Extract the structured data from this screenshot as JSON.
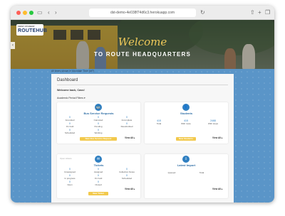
{
  "browser": {
    "url": "dst-demo-4e038f74d6c3.herokuapp.com"
  },
  "hero": {
    "logo_small": "FIRST STUDENT",
    "logo_main": "ROUTEHUB",
    "welcome": "Welcome",
    "subtitle": "TO ROUTE HEADQUARTERS"
  },
  "timezone_note": "All times shown in Mountain Time (MT)",
  "page": {
    "title": "Dashboard",
    "welcome_back": "Welcome back, Cass!",
    "filter_label": "Academic Period Filters ▾"
  },
  "bus_service": {
    "title": "Bus Service Requests",
    "stats": [
      {
        "value": "0",
        "label": "Amended"
      },
      {
        "value": "0",
        "label": "Canceled"
      },
      {
        "value": "0",
        "label": "Incomplete"
      },
      {
        "value": "0",
        "label": "On hold"
      },
      {
        "value": "0",
        "label": "Pending"
      },
      {
        "value": "0",
        "label": "Resubmitted"
      },
      {
        "value": "0",
        "label": "Scheduled"
      },
      {
        "value": "0",
        "label": "Working"
      }
    ],
    "button": "New Bus Service Request",
    "view_all": "View All ▸"
  },
  "students": {
    "title": "Students",
    "stats": [
      {
        "value": "415",
        "label": "Total"
      },
      {
        "value": "415",
        "label": "With route"
      },
      {
        "value": "2468",
        "label": "With stops"
      }
    ],
    "button": "New Students",
    "view_all": "View All ▸"
  },
  "tickets": {
    "subheading": "Open tickets",
    "title": "Tickets",
    "stats": [
      {
        "value": "0",
        "label": "Unassigned"
      },
      {
        "value": "0",
        "label": "Assigned"
      },
      {
        "value": "0",
        "label": "Collection Notes"
      },
      {
        "value": "0",
        "label": "In progress"
      },
      {
        "value": "0",
        "label": "On hold"
      },
      {
        "value": "0",
        "label": "Scheduled"
      },
      {
        "value": "0",
        "label": "Open"
      },
      {
        "value": "0",
        "label": "Closed"
      }
    ],
    "button": "New Ticket",
    "view_all": "View All ▸"
  },
  "latest_import": {
    "title": "Latest Import",
    "stats": [
      {
        "value": "",
        "label": "Queued"
      },
      {
        "value": "",
        "label": "Total"
      }
    ],
    "view_all": "View All ▸"
  }
}
